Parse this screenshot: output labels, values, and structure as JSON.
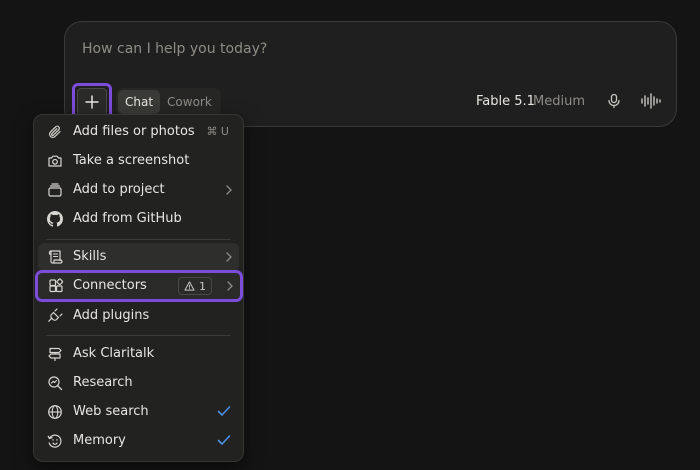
{
  "composer": {
    "placeholder": "How can I help you today?",
    "modes": [
      "Chat",
      "Cowork"
    ],
    "active_mode": "Chat",
    "model_name": "Fable 5.1",
    "model_effort": "Medium",
    "icons": {
      "attach": "plus-icon",
      "mic": "microphone-icon",
      "voice": "voice-waveform-icon"
    }
  },
  "menu": {
    "items": [
      {
        "label": "Add files or photos",
        "icon": "paperclip-icon",
        "shortcut": "⌘ U"
      },
      {
        "label": "Take a screenshot",
        "icon": "camera-icon"
      },
      {
        "label": "Add to project",
        "icon": "project-stack-icon",
        "has_submenu": true
      },
      {
        "label": "Add from GitHub",
        "icon": "github-icon"
      },
      {
        "label": "Skills",
        "icon": "skills-scroll-icon",
        "has_submenu": true,
        "hovered": true
      },
      {
        "label": "Connectors",
        "icon": "connectors-icon",
        "has_submenu": true,
        "badge": "1",
        "badge_icon": "warning-icon",
        "focused": true
      },
      {
        "label": "Add plugins",
        "icon": "plug-icon"
      },
      {
        "label": "Ask Claritalk",
        "icon": "signpost-icon"
      },
      {
        "label": "Research",
        "icon": "research-icon"
      },
      {
        "label": "Web search",
        "icon": "globe-icon",
        "checked": true
      },
      {
        "label": "Memory",
        "icon": "memory-icon",
        "checked": true
      }
    ]
  },
  "colors": {
    "background": "#141414",
    "surface": "#1f1f1f",
    "menu_surface": "#222220",
    "text": "#e8e6e1",
    "muted_text": "#8e8c86",
    "focus_ring": "#7c4ddb",
    "check": "#4a8fe8"
  }
}
